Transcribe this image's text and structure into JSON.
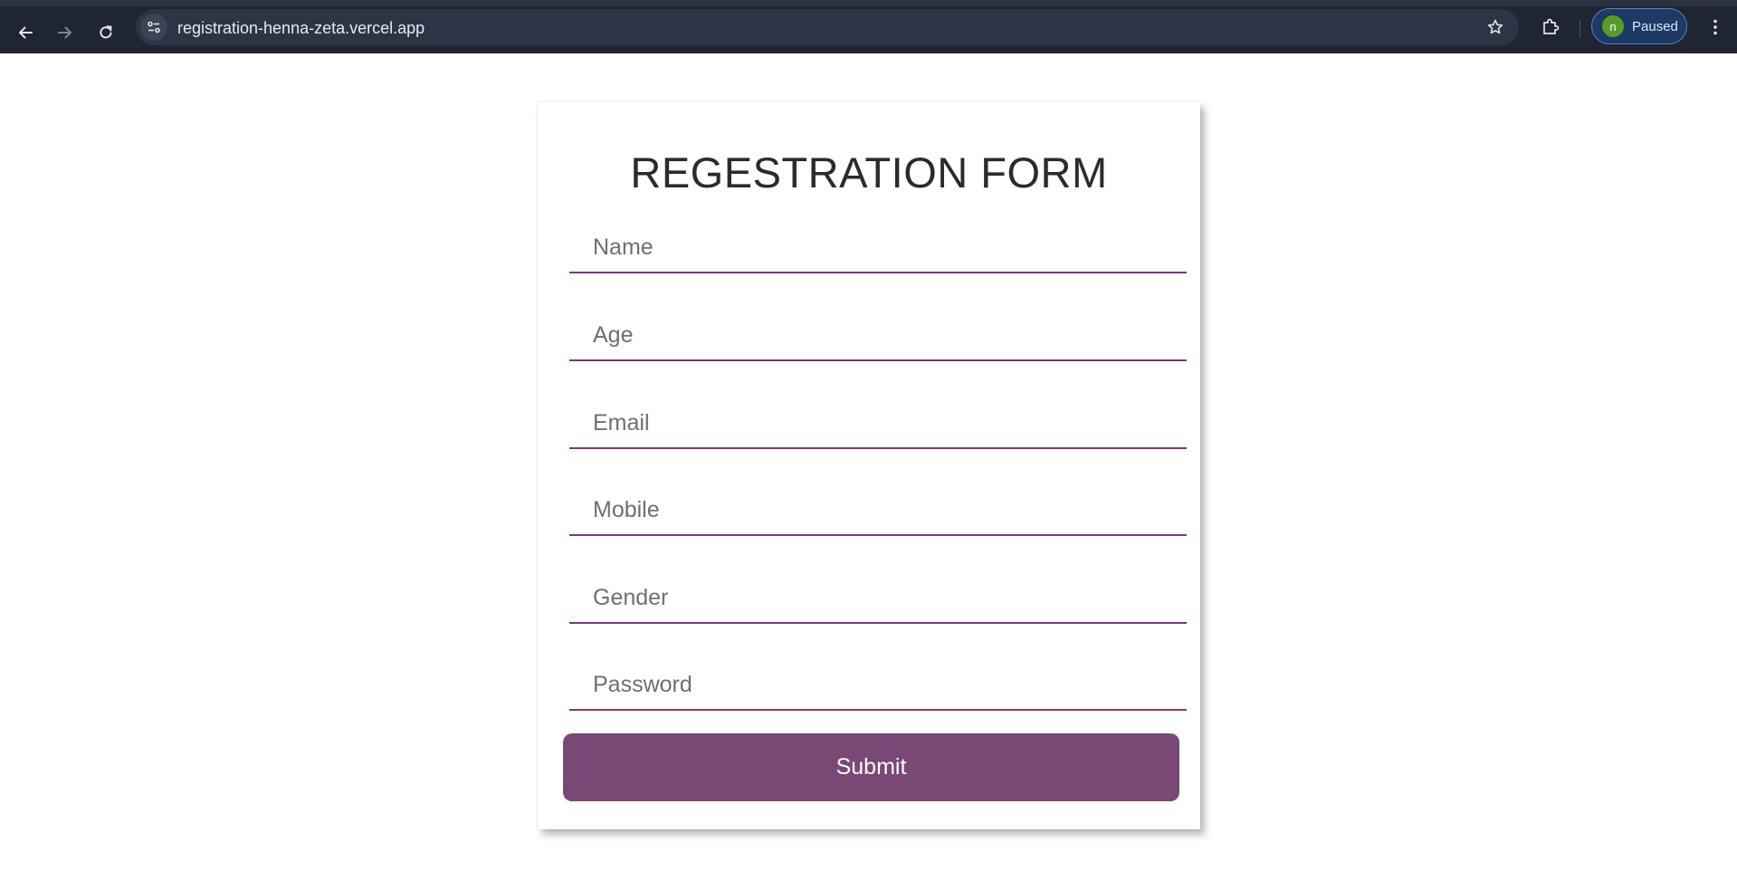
{
  "browser": {
    "url": "registration-henna-zeta.vercel.app",
    "profile_initial": "n",
    "profile_status": "Paused",
    "icons": {
      "back": "arrow-left-icon",
      "forward": "arrow-right-icon",
      "reload": "reload-icon",
      "site_info": "tune-icon",
      "bookmark": "star-icon",
      "extensions": "puzzle-icon",
      "menu": "kebab-menu-icon"
    },
    "colors": {
      "toolbar_bg": "#1f2532",
      "omnibox_bg": "#2c3445",
      "profile_chip_bg": "#1d3a64",
      "avatar_bg": "#5a9a2a"
    }
  },
  "form": {
    "title": "REGESTRATION FORM",
    "fields": [
      {
        "name": "name",
        "placeholder": "Name",
        "value": ""
      },
      {
        "name": "age",
        "placeholder": "Age",
        "value": ""
      },
      {
        "name": "email",
        "placeholder": "Email",
        "value": ""
      },
      {
        "name": "mobile",
        "placeholder": "Mobile",
        "value": ""
      },
      {
        "name": "gender",
        "placeholder": "Gender",
        "value": ""
      },
      {
        "name": "password",
        "placeholder": "Password",
        "value": ""
      }
    ],
    "submit_label": "Submit",
    "colors": {
      "accent": "#7a4875",
      "field_underline": "#7a3a78",
      "title_text": "#2b2b2b"
    }
  }
}
